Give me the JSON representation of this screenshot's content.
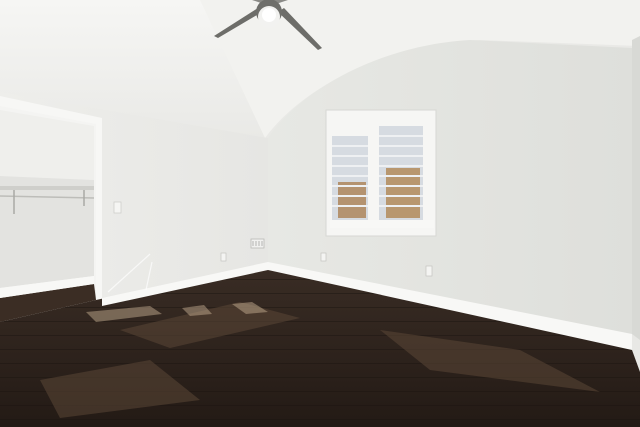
{
  "scene": {
    "subject": "empty-bedroom-interior",
    "palette": {
      "ceiling": "#f3f3f1",
      "wall_left": "#ededea",
      "wall_right": "#e4e5e1",
      "baseboard": "#f8f8f6",
      "floor": "#2e231d",
      "floor_highlight": "#4a3a2f",
      "closet_interior": "#e6e6e3",
      "window_frame": "#f6f6f4",
      "blind": "#d9dde2",
      "view_exterior": "#b49370"
    },
    "objects": [
      {
        "name": "ceiling-fan",
        "icon": "ceiling-fan-icon"
      },
      {
        "name": "window",
        "icon": "window-icon"
      },
      {
        "name": "closet",
        "icon": "closet-icon"
      },
      {
        "name": "floor-vent",
        "icon": "vent-icon"
      },
      {
        "name": "outlet",
        "icon": "outlet-icon"
      },
      {
        "name": "light-switch",
        "icon": "switch-icon"
      }
    ]
  }
}
